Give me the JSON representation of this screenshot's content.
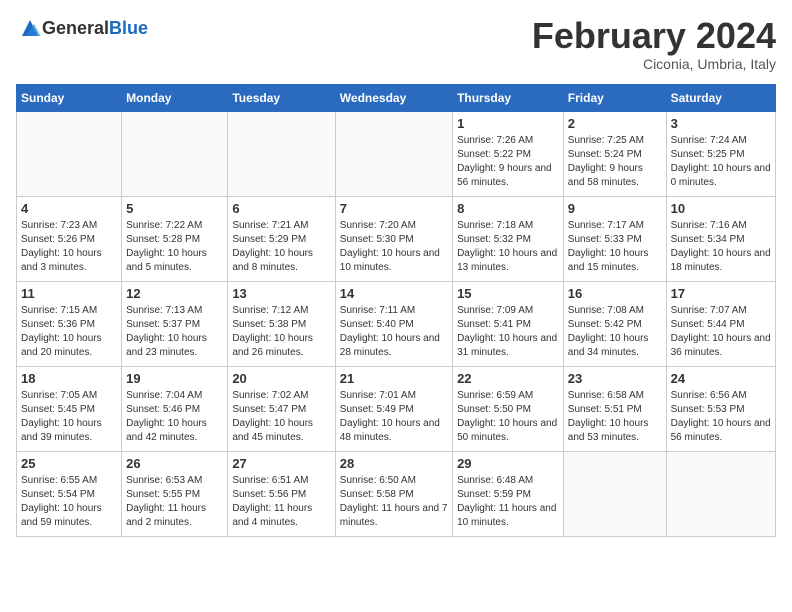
{
  "header": {
    "logo": {
      "general": "General",
      "blue": "Blue"
    },
    "title": "February 2024",
    "location": "Ciconia, Umbria, Italy"
  },
  "calendar": {
    "days_of_week": [
      "Sunday",
      "Monday",
      "Tuesday",
      "Wednesday",
      "Thursday",
      "Friday",
      "Saturday"
    ],
    "weeks": [
      [
        {
          "day": "",
          "sunrise": "",
          "sunset": "",
          "daylight": "",
          "empty": true
        },
        {
          "day": "",
          "sunrise": "",
          "sunset": "",
          "daylight": "",
          "empty": true
        },
        {
          "day": "",
          "sunrise": "",
          "sunset": "",
          "daylight": "",
          "empty": true
        },
        {
          "day": "",
          "sunrise": "",
          "sunset": "",
          "daylight": "",
          "empty": true
        },
        {
          "day": "1",
          "sunrise": "Sunrise: 7:26 AM",
          "sunset": "Sunset: 5:22 PM",
          "daylight": "Daylight: 9 hours and 56 minutes.",
          "empty": false
        },
        {
          "day": "2",
          "sunrise": "Sunrise: 7:25 AM",
          "sunset": "Sunset: 5:24 PM",
          "daylight": "Daylight: 9 hours and 58 minutes.",
          "empty": false
        },
        {
          "day": "3",
          "sunrise": "Sunrise: 7:24 AM",
          "sunset": "Sunset: 5:25 PM",
          "daylight": "Daylight: 10 hours and 0 minutes.",
          "empty": false
        }
      ],
      [
        {
          "day": "4",
          "sunrise": "Sunrise: 7:23 AM",
          "sunset": "Sunset: 5:26 PM",
          "daylight": "Daylight: 10 hours and 3 minutes.",
          "empty": false
        },
        {
          "day": "5",
          "sunrise": "Sunrise: 7:22 AM",
          "sunset": "Sunset: 5:28 PM",
          "daylight": "Daylight: 10 hours and 5 minutes.",
          "empty": false
        },
        {
          "day": "6",
          "sunrise": "Sunrise: 7:21 AM",
          "sunset": "Sunset: 5:29 PM",
          "daylight": "Daylight: 10 hours and 8 minutes.",
          "empty": false
        },
        {
          "day": "7",
          "sunrise": "Sunrise: 7:20 AM",
          "sunset": "Sunset: 5:30 PM",
          "daylight": "Daylight: 10 hours and 10 minutes.",
          "empty": false
        },
        {
          "day": "8",
          "sunrise": "Sunrise: 7:18 AM",
          "sunset": "Sunset: 5:32 PM",
          "daylight": "Daylight: 10 hours and 13 minutes.",
          "empty": false
        },
        {
          "day": "9",
          "sunrise": "Sunrise: 7:17 AM",
          "sunset": "Sunset: 5:33 PM",
          "daylight": "Daylight: 10 hours and 15 minutes.",
          "empty": false
        },
        {
          "day": "10",
          "sunrise": "Sunrise: 7:16 AM",
          "sunset": "Sunset: 5:34 PM",
          "daylight": "Daylight: 10 hours and 18 minutes.",
          "empty": false
        }
      ],
      [
        {
          "day": "11",
          "sunrise": "Sunrise: 7:15 AM",
          "sunset": "Sunset: 5:36 PM",
          "daylight": "Daylight: 10 hours and 20 minutes.",
          "empty": false
        },
        {
          "day": "12",
          "sunrise": "Sunrise: 7:13 AM",
          "sunset": "Sunset: 5:37 PM",
          "daylight": "Daylight: 10 hours and 23 minutes.",
          "empty": false
        },
        {
          "day": "13",
          "sunrise": "Sunrise: 7:12 AM",
          "sunset": "Sunset: 5:38 PM",
          "daylight": "Daylight: 10 hours and 26 minutes.",
          "empty": false
        },
        {
          "day": "14",
          "sunrise": "Sunrise: 7:11 AM",
          "sunset": "Sunset: 5:40 PM",
          "daylight": "Daylight: 10 hours and 28 minutes.",
          "empty": false
        },
        {
          "day": "15",
          "sunrise": "Sunrise: 7:09 AM",
          "sunset": "Sunset: 5:41 PM",
          "daylight": "Daylight: 10 hours and 31 minutes.",
          "empty": false
        },
        {
          "day": "16",
          "sunrise": "Sunrise: 7:08 AM",
          "sunset": "Sunset: 5:42 PM",
          "daylight": "Daylight: 10 hours and 34 minutes.",
          "empty": false
        },
        {
          "day": "17",
          "sunrise": "Sunrise: 7:07 AM",
          "sunset": "Sunset: 5:44 PM",
          "daylight": "Daylight: 10 hours and 36 minutes.",
          "empty": false
        }
      ],
      [
        {
          "day": "18",
          "sunrise": "Sunrise: 7:05 AM",
          "sunset": "Sunset: 5:45 PM",
          "daylight": "Daylight: 10 hours and 39 minutes.",
          "empty": false
        },
        {
          "day": "19",
          "sunrise": "Sunrise: 7:04 AM",
          "sunset": "Sunset: 5:46 PM",
          "daylight": "Daylight: 10 hours and 42 minutes.",
          "empty": false
        },
        {
          "day": "20",
          "sunrise": "Sunrise: 7:02 AM",
          "sunset": "Sunset: 5:47 PM",
          "daylight": "Daylight: 10 hours and 45 minutes.",
          "empty": false
        },
        {
          "day": "21",
          "sunrise": "Sunrise: 7:01 AM",
          "sunset": "Sunset: 5:49 PM",
          "daylight": "Daylight: 10 hours and 48 minutes.",
          "empty": false
        },
        {
          "day": "22",
          "sunrise": "Sunrise: 6:59 AM",
          "sunset": "Sunset: 5:50 PM",
          "daylight": "Daylight: 10 hours and 50 minutes.",
          "empty": false
        },
        {
          "day": "23",
          "sunrise": "Sunrise: 6:58 AM",
          "sunset": "Sunset: 5:51 PM",
          "daylight": "Daylight: 10 hours and 53 minutes.",
          "empty": false
        },
        {
          "day": "24",
          "sunrise": "Sunrise: 6:56 AM",
          "sunset": "Sunset: 5:53 PM",
          "daylight": "Daylight: 10 hours and 56 minutes.",
          "empty": false
        }
      ],
      [
        {
          "day": "25",
          "sunrise": "Sunrise: 6:55 AM",
          "sunset": "Sunset: 5:54 PM",
          "daylight": "Daylight: 10 hours and 59 minutes.",
          "empty": false
        },
        {
          "day": "26",
          "sunrise": "Sunrise: 6:53 AM",
          "sunset": "Sunset: 5:55 PM",
          "daylight": "Daylight: 11 hours and 2 minutes.",
          "empty": false
        },
        {
          "day": "27",
          "sunrise": "Sunrise: 6:51 AM",
          "sunset": "Sunset: 5:56 PM",
          "daylight": "Daylight: 11 hours and 4 minutes.",
          "empty": false
        },
        {
          "day": "28",
          "sunrise": "Sunrise: 6:50 AM",
          "sunset": "Sunset: 5:58 PM",
          "daylight": "Daylight: 11 hours and 7 minutes.",
          "empty": false
        },
        {
          "day": "29",
          "sunrise": "Sunrise: 6:48 AM",
          "sunset": "Sunset: 5:59 PM",
          "daylight": "Daylight: 11 hours and 10 minutes.",
          "empty": false
        },
        {
          "day": "",
          "sunrise": "",
          "sunset": "",
          "daylight": "",
          "empty": true
        },
        {
          "day": "",
          "sunrise": "",
          "sunset": "",
          "daylight": "",
          "empty": true
        }
      ]
    ]
  }
}
